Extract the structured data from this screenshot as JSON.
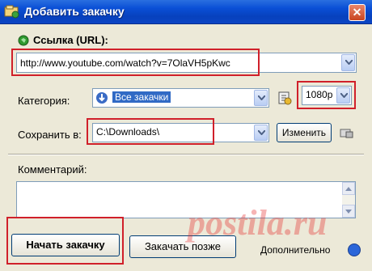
{
  "window": {
    "title": "Добавить закачку",
    "close_symbol": "✕"
  },
  "url": {
    "label": "Ссылка (URL):",
    "value": "http://www.youtube.com/watch?v=7OlaVH5pKwc"
  },
  "category": {
    "label": "Категория:",
    "value": "Все закачки",
    "quality_value": "1080p"
  },
  "save": {
    "label": "Сохранить в:",
    "path": "C:\\Downloads\\",
    "change_button": "Изменить"
  },
  "comment": {
    "label": "Комментарий:",
    "value": ""
  },
  "footer": {
    "start_button": "Начать закачку",
    "later_button": "Закачать позже",
    "advanced_link": "Дополнительно"
  },
  "watermark": "postila.ru",
  "colors": {
    "titlebar": "#0a4fd6",
    "highlight_box": "#d0202a",
    "selection": "#316ac5"
  }
}
